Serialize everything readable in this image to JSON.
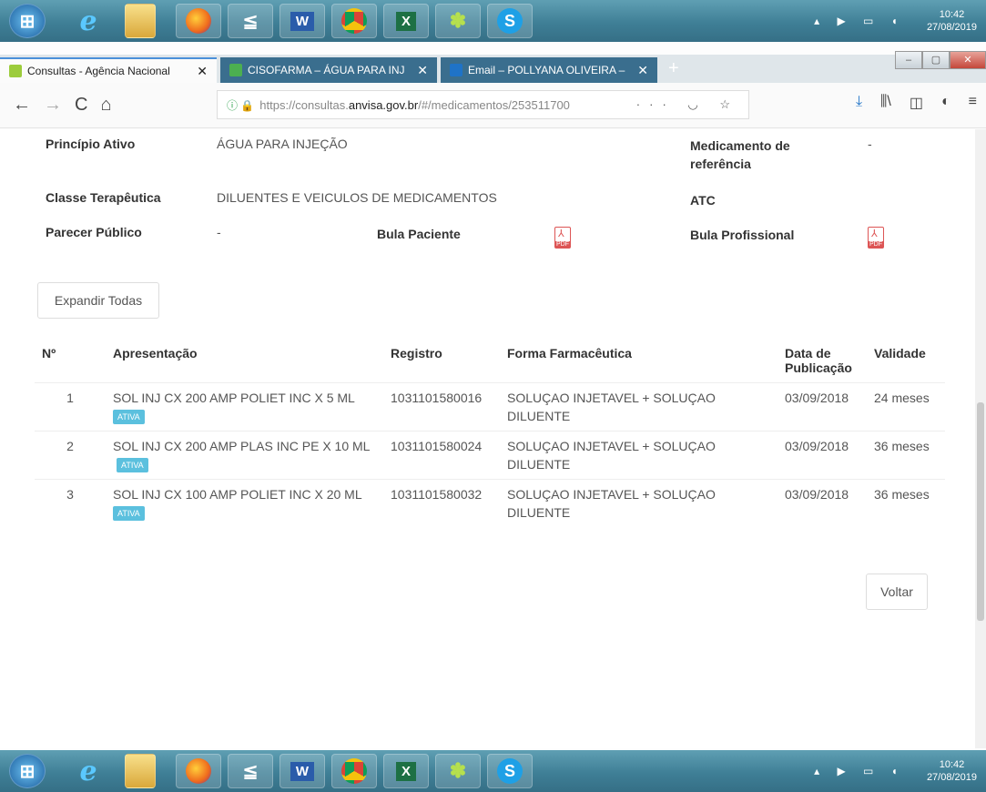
{
  "taskbar": {
    "apps": [
      {
        "name": "start",
        "label": "⊞"
      },
      {
        "name": "ie",
        "label": "e"
      },
      {
        "name": "folder",
        "label": ""
      },
      {
        "name": "firefox",
        "label": ""
      },
      {
        "name": "scanner",
        "label": "≦"
      },
      {
        "name": "word",
        "label": "W"
      },
      {
        "name": "chrome",
        "label": ""
      },
      {
        "name": "excel",
        "label": "X"
      },
      {
        "name": "app",
        "label": "✽"
      },
      {
        "name": "skype",
        "label": "S"
      }
    ],
    "tray_icons": "▴ ▶ ▭ ◖",
    "time": "10:42",
    "date": "27/08/2019"
  },
  "tabs": [
    {
      "title": "Consultas - Agência Nacional",
      "close": "✕",
      "color": "#9ccc3c"
    },
    {
      "title": "CISOFARMA – ÁGUA PARA INJ",
      "close": "✕",
      "color": "#4caf50"
    },
    {
      "title": "Email – POLLYANA OLIVEIRA –",
      "close": "✕",
      "color": "#1f73c7"
    }
  ],
  "new_tab": "+",
  "window_controls": {
    "minimize": "–",
    "maximize": "▢",
    "close": "✕"
  },
  "nav": {
    "back": "←",
    "forward": "→",
    "reload": "C",
    "home": "⌂",
    "url_prefix": "https://consultas.",
    "url_host": "anvisa.gov.br",
    "url_rest": "/#/medicamentos/253511700",
    "url_actions": "··· ◡ ☆",
    "right_icons": [
      "⤓",
      "⫼\\",
      "◫",
      "◐",
      "≡"
    ]
  },
  "info": {
    "principio_ativo_label": "Princípio Ativo",
    "principio_ativo_value": "ÁGUA PARA INJEÇÃO",
    "medicamento_ref_label": "Medicamento de referência",
    "medicamento_ref_value": "-",
    "classe_label": "Classe Terapêutica",
    "classe_value": "DILUENTES E VEICULOS DE MEDICAMENTOS",
    "atc_label": "ATC",
    "parecer_label": "Parecer Público",
    "parecer_value": "-",
    "bula_paciente_label": "Bula Paciente",
    "bula_profissional_label": "Bula Profissional"
  },
  "expand_button": "Expandir Todas",
  "table": {
    "headers": [
      "Nº",
      "Apresentação",
      "Registro",
      "Forma Farmacêutica",
      "Data de Publicação",
      "Validade"
    ],
    "rows": [
      {
        "n": "1",
        "apresentacao": "SOL INJ CX 200 AMP POLIET INC X 5 ML",
        "badge": "ATIVA",
        "registro": "1031101580016",
        "forma": "SOLUÇAO INJETAVEL + SOLUÇAO DILUENTE",
        "data": "03/09/2018",
        "validade": "24 meses"
      },
      {
        "n": "2",
        "apresentacao": "SOL INJ CX 200 AMP PLAS INC PE X 10 ML",
        "badge": "ATIVA",
        "registro": "1031101580024",
        "forma": "SOLUÇAO INJETAVEL + SOLUÇAO DILUENTE",
        "data": "03/09/2018",
        "validade": "36 meses"
      },
      {
        "n": "3",
        "apresentacao": "SOL INJ CX 100 AMP POLIET INC X 20 ML",
        "badge": "ATIVA",
        "registro": "1031101580032",
        "forma": "SOLUÇAO INJETAVEL + SOLUÇAO DILUENTE",
        "data": "03/09/2018",
        "validade": "36 meses"
      }
    ]
  },
  "back_button": "Voltar"
}
